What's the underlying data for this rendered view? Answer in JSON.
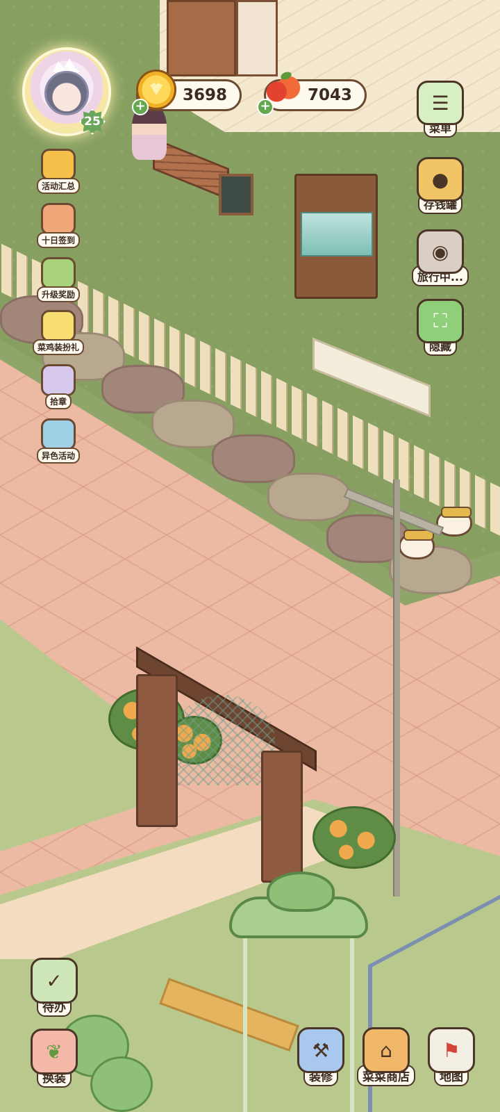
{
  "player": {
    "level": "25"
  },
  "currency": {
    "coins": "3698",
    "apples": "7043",
    "coin_icon": "gold-heart-coin-icon",
    "apple_icon": "red-apple-icon"
  },
  "left_menu": [
    {
      "label": "活动汇总",
      "icon": "event-summary-icon",
      "color": "#f5c04a"
    },
    {
      "label": "十日签到",
      "icon": "ten-day-checkin-icon",
      "color": "#f0a87a"
    },
    {
      "label": "升级奖励",
      "icon": "level-up-reward-icon",
      "color": "#a8d37a"
    },
    {
      "label": "菜鸡装扮礼",
      "icon": "chick-outfit-gift-icon",
      "color": "#f7dd72"
    },
    {
      "label": "拾章",
      "icon": "badge-collect-icon",
      "color": "#d7c8ee"
    },
    {
      "label": "异色活动",
      "icon": "rainbow-event-icon",
      "color": "#9fd0e6"
    }
  ],
  "right_menu": [
    {
      "label": "菜单",
      "icon": "menu-list-icon",
      "color": "#d8efc4"
    },
    {
      "label": "存钱罐",
      "icon": "piggy-bank-icon",
      "color": "#f1c565"
    },
    {
      "label": "旅行中...",
      "icon": "camera-icon",
      "color": "#d9cfc4"
    },
    {
      "label": "隐藏",
      "icon": "hide-frame-icon",
      "color": "#8fcf7a"
    }
  ],
  "bottom_left": [
    {
      "label": "待办",
      "icon": "todo-checklist-icon",
      "color": "#cfe7b8"
    },
    {
      "label": "换装",
      "icon": "radish-outfit-icon",
      "color": "#f4b8a8"
    }
  ],
  "bottom_right": [
    {
      "label": "装修",
      "icon": "decorate-chick-icon",
      "color": "#a8c8ee"
    },
    {
      "label": "菜菜商店",
      "icon": "shop-stall-icon",
      "color": "#f2b86a"
    },
    {
      "label": "地图",
      "icon": "map-icon",
      "color": "#f3efe4"
    }
  ]
}
